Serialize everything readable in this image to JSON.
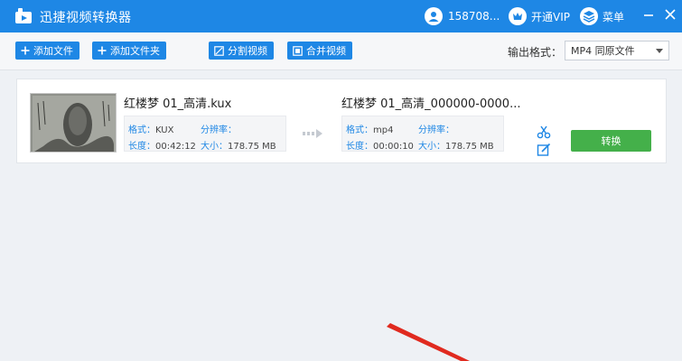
{
  "titlebar": {
    "app_title": "迅捷视频转换器",
    "user_name": "158708...",
    "vip_label": "开通VIP",
    "menu_label": "菜单"
  },
  "toolbar": {
    "add_file": "添加文件",
    "add_folder": "添加文件夹",
    "split_video": "分割视频",
    "merge_video": "合并视频",
    "output_format_label": "输出格式：",
    "output_format_value": "MP4  同原文件"
  },
  "file": {
    "source": {
      "name": "红楼梦 01_高清.kux",
      "format_label": "格式：",
      "format_value": "KUX",
      "resolution_label": "分辨率：",
      "resolution_value": "",
      "duration_label": "长度：",
      "duration_value": "00:42:12",
      "size_label": "大小：",
      "size_value": "178.75 MB"
    },
    "target": {
      "name": "红楼梦 01_高清_000000-0000...",
      "format_label": "格式：",
      "format_value": "mp4",
      "resolution_label": "分辨率：",
      "resolution_value": "",
      "duration_label": "长度：",
      "duration_value": "00:00:10",
      "size_label": "大小：",
      "size_value": "178.75 MB"
    },
    "convert_label": "转换"
  },
  "colors": {
    "accent_blue": "#1e87e5",
    "convert_green": "#44b04a",
    "annotation_red": "#e02a1f"
  },
  "icons": [
    "app-logo-icon",
    "user-icon",
    "vip-icon",
    "menu-icon",
    "minimize-icon",
    "close-icon",
    "plus-icon",
    "split-icon",
    "merge-icon",
    "scissors-icon",
    "edit-icon",
    "chevron-down-icon"
  ]
}
